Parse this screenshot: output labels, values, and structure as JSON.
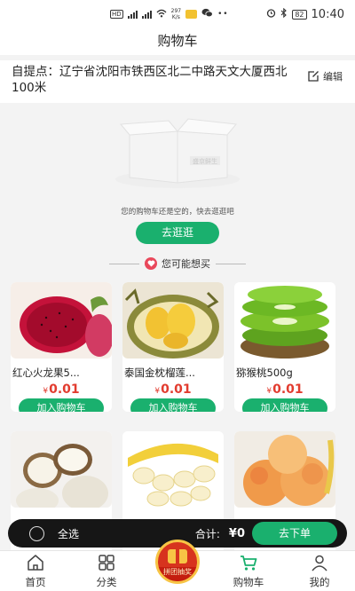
{
  "status_bar": {
    "time": "10:40",
    "network_speed": "297\nK/s",
    "battery": "82"
  },
  "header": {
    "title": "购物车"
  },
  "address": {
    "text": "自提点：辽宁省沈阳市铁西区北二中路天文大厦西北100米",
    "edit_label": "编辑"
  },
  "empty_cart": {
    "box_label": "盛京鲜生",
    "message": "您的购物车还是空的，快去逛逛吧",
    "go_button": "去逛逛"
  },
  "recommend": {
    "title": "您可能想买",
    "products": [
      {
        "name": "红心火龙果5...",
        "currency": "¥",
        "price": "0.01",
        "add_label": "加入购物车",
        "image": "dragon-fruit-image"
      },
      {
        "name": "泰国金枕榴莲...",
        "currency": "¥",
        "price": "0.01",
        "add_label": "加入购物车",
        "image": "durian-image"
      },
      {
        "name": "猕猴桃500g",
        "currency": "¥",
        "price": "0.01",
        "add_label": "加入购物车",
        "image": "kiwi-image"
      },
      {
        "name": "",
        "currency": "",
        "price": "",
        "add_label": "",
        "image": "coconut-image"
      },
      {
        "name": "",
        "currency": "",
        "price": "",
        "add_label": "",
        "image": "banana-image"
      },
      {
        "name": "",
        "currency": "",
        "price": "",
        "add_label": "",
        "image": "peach-image"
      }
    ]
  },
  "checkout": {
    "select_all": "全选",
    "total_label": "合计:",
    "total_value": "¥0",
    "order_button": "去下单"
  },
  "tabbar": {
    "items": [
      {
        "label": "首页",
        "icon": "home-icon"
      },
      {
        "label": "分类",
        "icon": "category-icon"
      },
      {
        "label": "拼团抽奖",
        "icon": "lottery-icon"
      },
      {
        "label": "购物车",
        "icon": "cart-icon"
      },
      {
        "label": "我的",
        "icon": "user-icon"
      }
    ]
  },
  "colors": {
    "brand_green": "#1ab06e",
    "price_red": "#e23c2f",
    "checkout_dark": "#161616"
  }
}
